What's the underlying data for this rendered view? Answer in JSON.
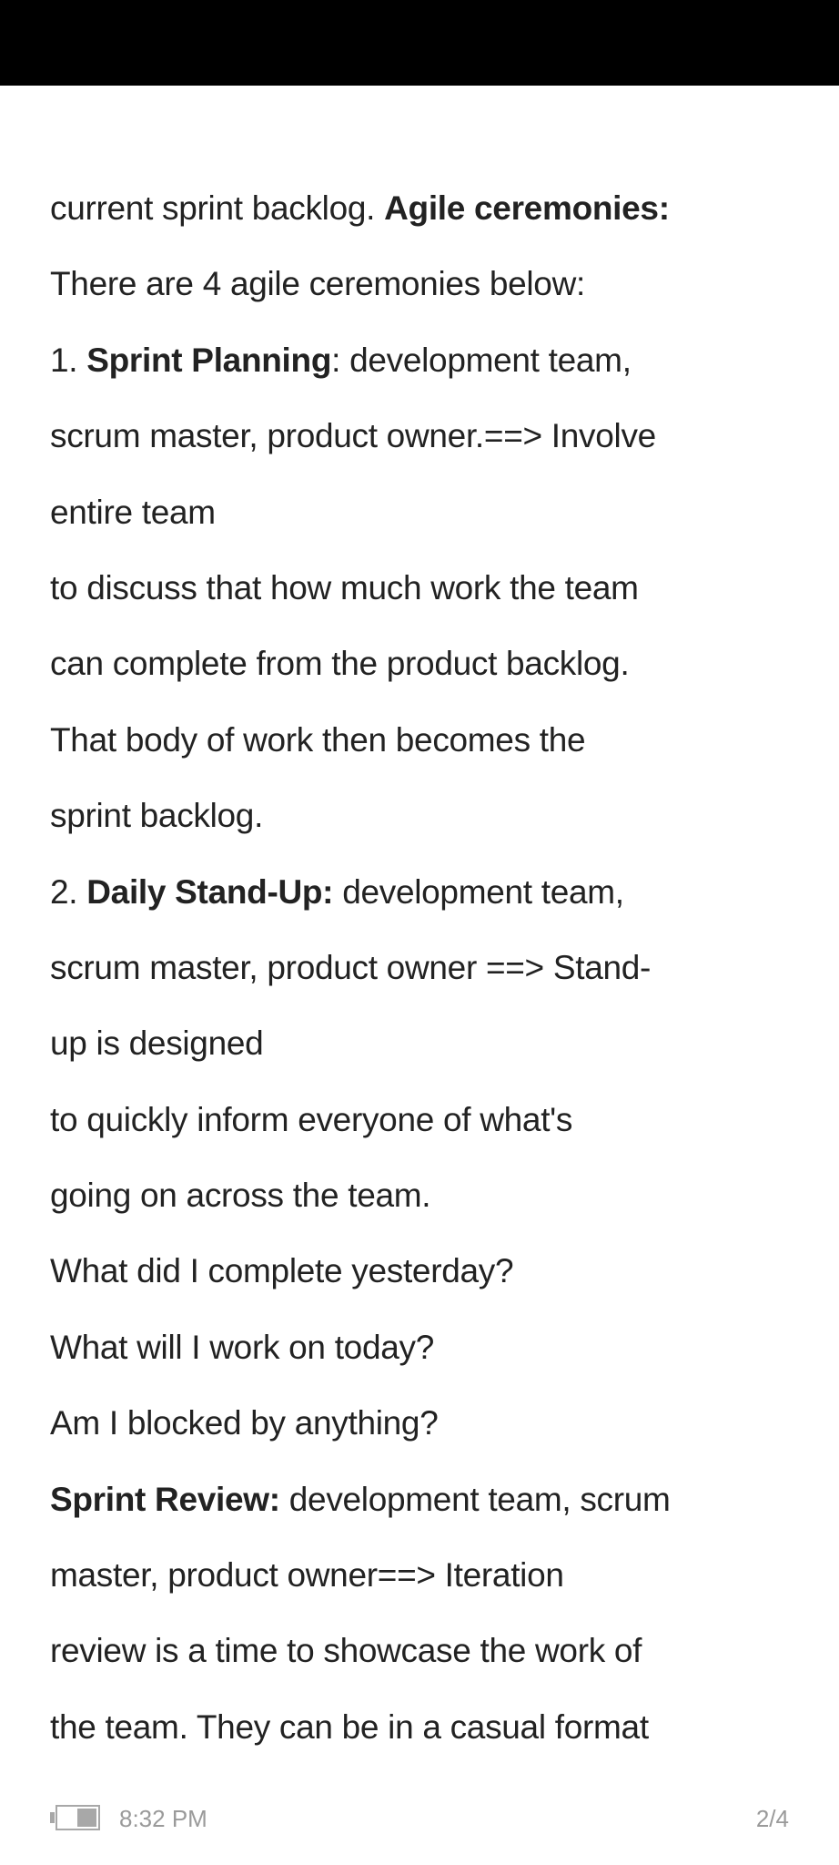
{
  "lines": [
    [
      {
        "t": "current sprint backlog. "
      },
      {
        "t": "Agile ceremonies:",
        "b": true
      }
    ],
    [
      {
        "t": "There are 4 agile ceremonies below:"
      }
    ],
    [
      {
        "t": "1. "
      },
      {
        "t": "Sprint Planning",
        "b": true
      },
      {
        "t": ": development team,"
      }
    ],
    [
      {
        "t": "scrum master, product owner.==> Involve"
      }
    ],
    [
      {
        "t": "entire team"
      }
    ],
    [
      {
        "t": "to discuss that how much work the team"
      }
    ],
    [
      {
        "t": "can complete from the product backlog."
      }
    ],
    [
      {
        "t": "That body of work then becomes the"
      }
    ],
    [
      {
        "t": "sprint backlog."
      }
    ],
    [
      {
        "t": "2. "
      },
      {
        "t": "Daily Stand-Up:",
        "b": true
      },
      {
        "t": " development team,"
      }
    ],
    [
      {
        "t": "scrum master, product owner ==> Stand-"
      }
    ],
    [
      {
        "t": "up is designed"
      }
    ],
    [
      {
        "t": "to quickly inform everyone of what's"
      }
    ],
    [
      {
        "t": "going on across the team."
      }
    ],
    [
      {
        "t": "What did I complete yesterday?"
      }
    ],
    [
      {
        "t": "What will I work on today?"
      }
    ],
    [
      {
        "t": "Am I blocked by anything?"
      }
    ],
    [
      {
        "t": "Sprint Review:",
        "b": true
      },
      {
        "t": " development team, scrum"
      }
    ],
    [
      {
        "t": "master, product owner==> Iteration"
      }
    ],
    [
      {
        "t": "review is a time to showcase the work of"
      }
    ],
    [
      {
        "t": "the team. They can be in a casual format"
      }
    ]
  ],
  "footer": {
    "time": "8:32 PM",
    "page": "2/4",
    "battery_icon": "battery-half-icon",
    "battery_level": 0.5
  }
}
